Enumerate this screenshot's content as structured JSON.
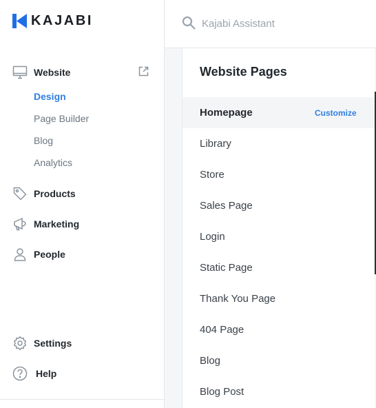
{
  "brand": {
    "name": "KAJABI",
    "color": "#1f6fe5"
  },
  "sidebar": {
    "website": {
      "label": "Website",
      "icon": "monitor-icon",
      "subitems": [
        {
          "label": "Design",
          "active": true
        },
        {
          "label": "Page Builder",
          "active": false
        },
        {
          "label": "Blog",
          "active": false
        },
        {
          "label": "Analytics",
          "active": false
        }
      ]
    },
    "products": {
      "label": "Products",
      "icon": "tag-icon"
    },
    "marketing": {
      "label": "Marketing",
      "icon": "megaphone-icon"
    },
    "people": {
      "label": "People",
      "icon": "user-icon"
    },
    "settings": {
      "label": "Settings",
      "icon": "gear-icon"
    },
    "help": {
      "label": "Help",
      "icon": "question-icon"
    }
  },
  "search": {
    "placeholder": "Kajabi Assistant",
    "value": ""
  },
  "panel": {
    "title": "Website Pages",
    "customize_label": "Customize",
    "pages": [
      {
        "label": "Homepage",
        "selected": true
      },
      {
        "label": "Library",
        "selected": false
      },
      {
        "label": "Store",
        "selected": false
      },
      {
        "label": "Sales Page",
        "selected": false
      },
      {
        "label": "Login",
        "selected": false
      },
      {
        "label": "Static Page",
        "selected": false
      },
      {
        "label": "Thank You Page",
        "selected": false
      },
      {
        "label": "404 Page",
        "selected": false
      },
      {
        "label": "Blog",
        "selected": false
      },
      {
        "label": "Blog Post",
        "selected": false
      }
    ]
  },
  "colors": {
    "accent": "#2f7fe0",
    "text": "#23282d",
    "muted": "#6c7680"
  }
}
